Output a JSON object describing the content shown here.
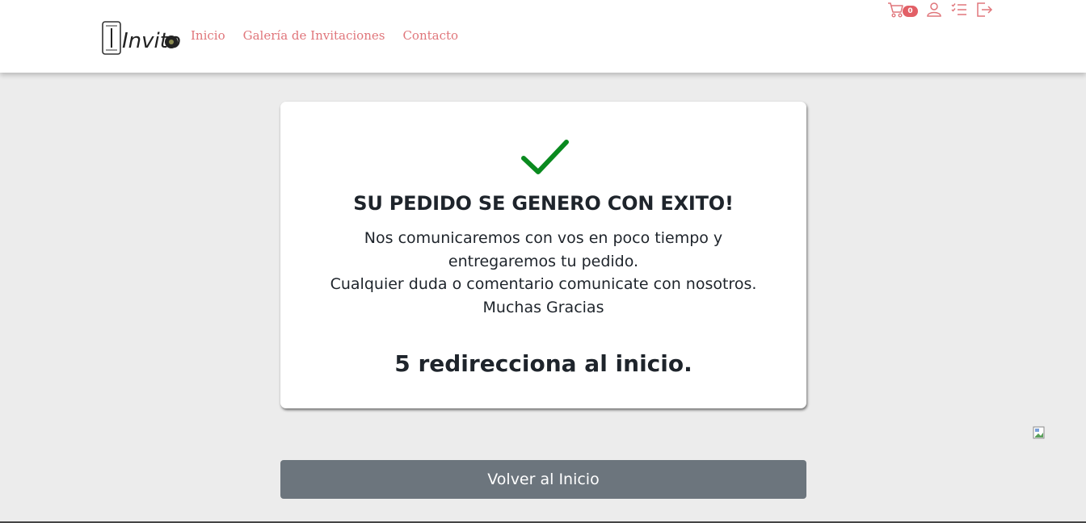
{
  "brand": {
    "logo_text": "Invito"
  },
  "nav": {
    "links": [
      {
        "label": "Inicio"
      },
      {
        "label": "Galería de Invitaciones"
      },
      {
        "label": "Contacto"
      }
    ],
    "cart_count": "0",
    "icons": [
      "cart-icon",
      "user-icon",
      "list-icon",
      "logout-icon"
    ]
  },
  "confirmation": {
    "title": "SU PEDIDO SE GENERO CON EXITO!",
    "message_line1": "Nos comunicaremos con vos en poco tiempo y entregaremos tu pedido.",
    "message_line2": "Cualquier duda o comentario comunicate con nosotros.",
    "message_line3": "Muchas Gracias",
    "redirect_text": "5 redirecciona al inicio."
  },
  "home_button": {
    "label": "Volver al Inicio"
  },
  "colors": {
    "accent": "#e0767b",
    "success": "#0a8a1f",
    "button": "#6c757d",
    "background": "#ececec"
  }
}
